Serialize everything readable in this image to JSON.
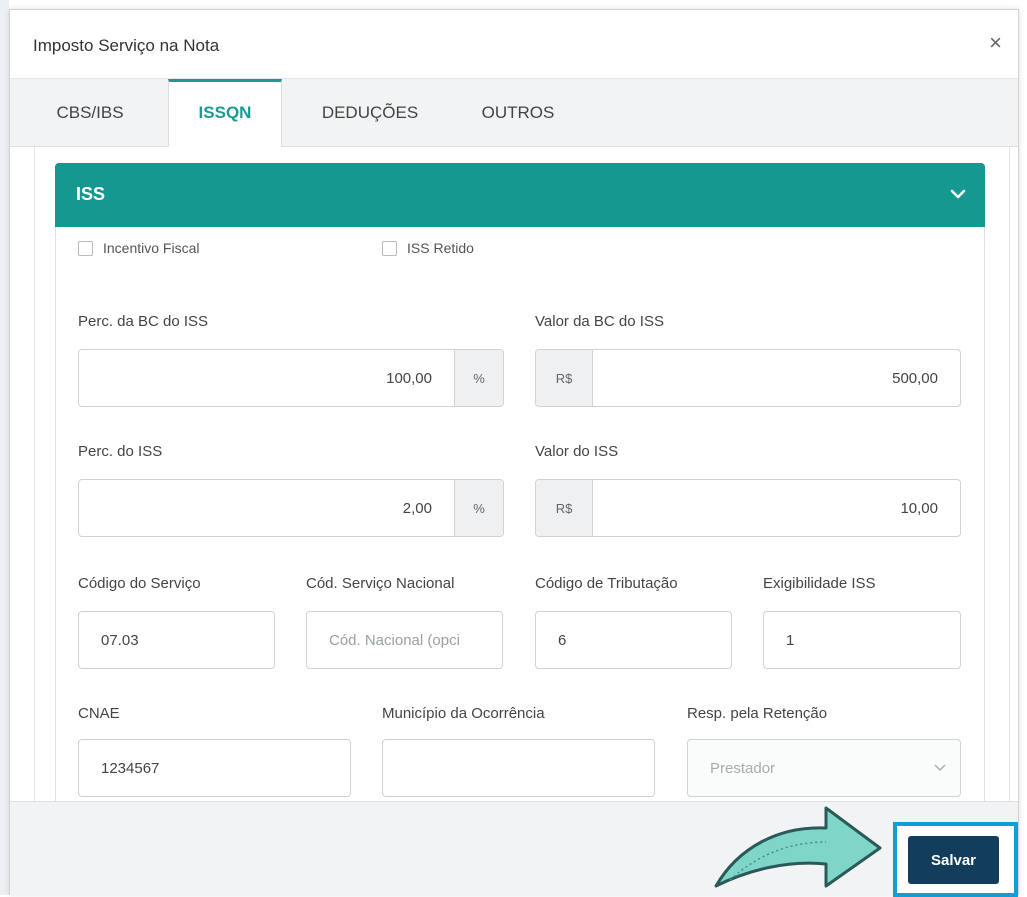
{
  "modal": {
    "title": "Imposto Serviço na Nota",
    "close_label": "×"
  },
  "tabs": [
    {
      "label": "CBS/IBS",
      "active": false
    },
    {
      "label": "ISSQN",
      "active": true
    },
    {
      "label": "DEDUÇÕES",
      "active": false
    },
    {
      "label": "OUTROS",
      "active": false
    }
  ],
  "section": {
    "title": "ISS"
  },
  "checkboxes": {
    "incentivo_fiscal": {
      "label": "Incentivo Fiscal",
      "checked": false
    },
    "iss_retido": {
      "label": "ISS Retido",
      "checked": false
    }
  },
  "fields": {
    "perc_bc_iss": {
      "label": "Perc. da BC do ISS",
      "value": "100,00",
      "suffix": "%"
    },
    "valor_bc_iss": {
      "label": "Valor da BC do ISS",
      "prefix": "R$",
      "value": "500,00"
    },
    "perc_iss": {
      "label": "Perc. do ISS",
      "value": "2,00",
      "suffix": "%"
    },
    "valor_iss": {
      "label": "Valor do ISS",
      "prefix": "R$",
      "value": "10,00"
    },
    "codigo_servico": {
      "label": "Código do Serviço",
      "value": "07.03"
    },
    "cod_servico_nacional": {
      "label": "Cód. Serviço Nacional",
      "placeholder": "Cód. Nacional (opci"
    },
    "codigo_tributacao": {
      "label": "Código de Tributação",
      "value": "6"
    },
    "exigibilidade_iss": {
      "label": "Exigibilidade ISS",
      "value": "1"
    },
    "cnae": {
      "label": "CNAE",
      "value": "1234567"
    },
    "municipio_ocorrencia": {
      "label": "Município da Ocorrência",
      "value": ""
    },
    "resp_retencao": {
      "label": "Resp. pela Retenção",
      "value": "Prestador"
    }
  },
  "footer": {
    "save_label": "Salvar"
  },
  "colors": {
    "accent": "#14988f",
    "save_button": "#123e5c",
    "highlight": "#0e9fd9",
    "arrow": "#7fd6c8"
  }
}
